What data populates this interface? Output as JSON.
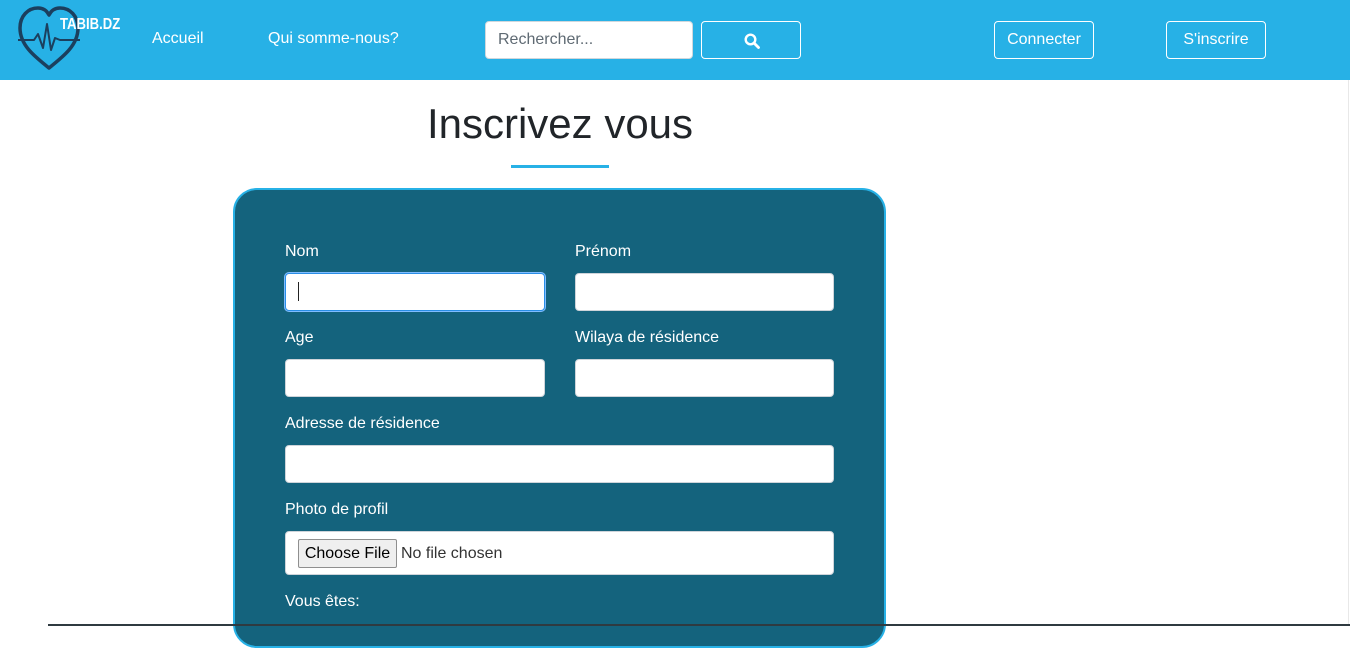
{
  "header": {
    "logo_text": "TABIB.DZ",
    "brand_color": "#27b1e6",
    "nav": [
      {
        "label": "Accueil"
      },
      {
        "label": "Qui somme-nous?"
      }
    ],
    "search": {
      "placeholder": "Rechercher...",
      "value": "",
      "button_icon": "search-icon"
    },
    "login_label": "Connecter",
    "signup_label": "S'inscrire"
  },
  "main": {
    "title": "Inscrivez vous",
    "accent_color": "#27b1e6",
    "form": {
      "background_color": "#14637d",
      "fields": {
        "nom": {
          "label": "Nom",
          "value": ""
        },
        "prenom": {
          "label": "Prénom",
          "value": ""
        },
        "age": {
          "label": "Age",
          "value": ""
        },
        "wilaya": {
          "label": "Wilaya de résidence",
          "value": ""
        },
        "adresse": {
          "label": "Adresse de résidence",
          "value": ""
        }
      },
      "photo": {
        "label": "Photo de profil",
        "button_label": "Choose File",
        "status": "No file chosen"
      },
      "role_label": "Vous êtes:"
    }
  }
}
